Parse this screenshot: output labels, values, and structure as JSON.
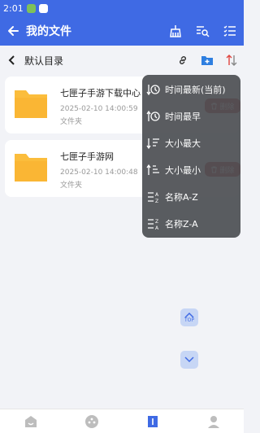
{
  "status": {
    "time": "2:01"
  },
  "header": {
    "title": "我的文件"
  },
  "breadcrumb": {
    "label": "默认目录"
  },
  "files": [
    {
      "name": "七匣子手游下载中心",
      "date": "2025-02-10 14:00:59",
      "type": "文件夹",
      "delete_label": "删除"
    },
    {
      "name": "七匣子手游网",
      "date": "2025-02-10 14:00:48",
      "type": "文件夹",
      "delete_label": "删除"
    }
  ],
  "sort_menu": {
    "items": [
      {
        "label": "时间最新(当前)",
        "icon": "sort-time-newest-icon"
      },
      {
        "label": "时间最早",
        "icon": "sort-time-oldest-icon"
      },
      {
        "label": "大小最大",
        "icon": "sort-size-largest-icon"
      },
      {
        "label": "大小最小",
        "icon": "sort-size-smallest-icon"
      },
      {
        "label": "名称A-Z",
        "icon": "sort-name-az-icon"
      },
      {
        "label": "名称Z-A",
        "icon": "sort-name-za-icon"
      }
    ]
  },
  "scroll": {
    "top_label": "TOP"
  },
  "colors": {
    "primary": "#3f6ae4",
    "folder": "#fbbd3c",
    "delete": "#b02a2a",
    "sort_accent": "#e0443e"
  }
}
